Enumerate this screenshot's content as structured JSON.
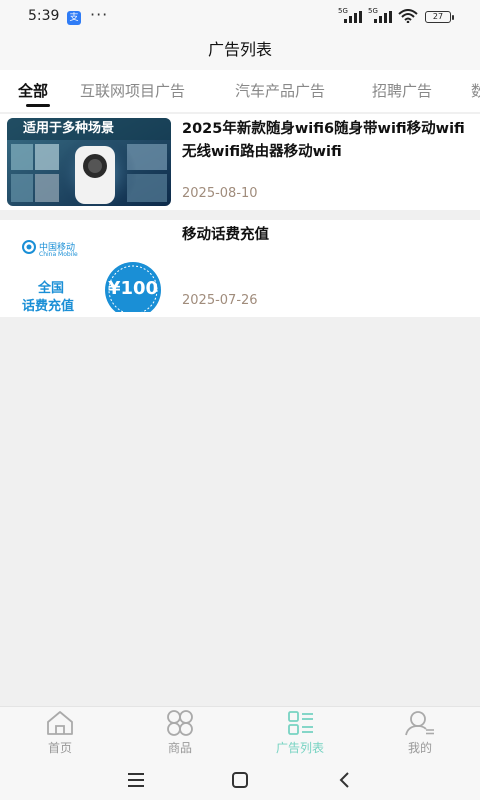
{
  "status_bar": {
    "time": "5:39",
    "app_badge": "支",
    "more": "···",
    "signal1_tag": "5G",
    "signal2_tag": "5G",
    "battery": "27"
  },
  "header": {
    "title": "广告列表"
  },
  "tabs": [
    {
      "label": "全部",
      "active": true
    },
    {
      "label": "互联网项目广告",
      "active": false
    },
    {
      "label": "汽车产品广告",
      "active": false
    },
    {
      "label": "招聘广告",
      "active": false
    },
    {
      "label": "数",
      "active": false
    }
  ],
  "ads": [
    {
      "title": "2025年新款随身wifi6随身带wifi移动wifi无线wifi路由器移动wifi",
      "date": "2025-08-10",
      "image_caption": "适用于多种场景"
    },
    {
      "title": "移动话费充值",
      "date": "2025-07-26",
      "logo_text": "中国移动",
      "logo_sub": "China Mobile",
      "promo_line1": "全国",
      "promo_line2": "话费充值",
      "promo_amount": "¥100"
    }
  ],
  "bottom_nav": [
    {
      "label": "首页",
      "icon": "home-icon",
      "active": false
    },
    {
      "label": "商品",
      "icon": "grid-icon",
      "active": false
    },
    {
      "label": "广告列表",
      "icon": "list-icon",
      "active": true
    },
    {
      "label": "我的",
      "icon": "user-icon",
      "active": false
    }
  ],
  "colors": {
    "accent": "#77d3c2",
    "date": "#a08c7c",
    "promo_blue": "#1a8fd6"
  }
}
